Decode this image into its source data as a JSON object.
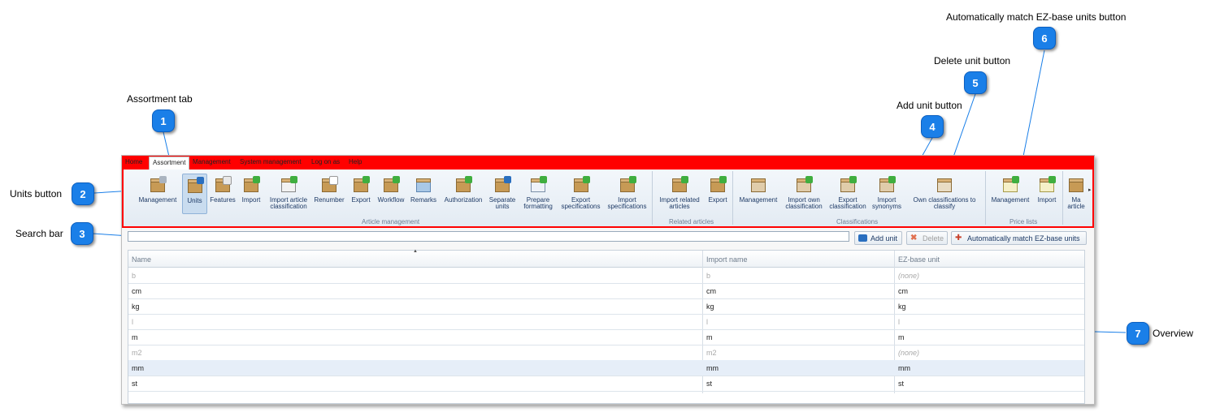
{
  "callouts": [
    {
      "number": "1",
      "label": "Assortment tab"
    },
    {
      "number": "2",
      "label": "Units button"
    },
    {
      "number": "3",
      "label": "Search bar"
    },
    {
      "number": "4",
      "label": "Add unit button"
    },
    {
      "number": "5",
      "label": "Delete unit button"
    },
    {
      "number": "6",
      "label": "Automatically match EZ-base units button"
    },
    {
      "number": "7",
      "label": "Overview"
    }
  ],
  "menu": [
    "Home",
    "Assortment",
    "Management",
    "System management",
    "Log on as",
    "Help"
  ],
  "ribbon": {
    "article_management": [
      "Management",
      "Units",
      "Features",
      "Import",
      "Import article classification",
      "Renumber",
      "Export",
      "Workflow",
      "Remarks",
      "Authorization",
      "Separate units",
      "Prepare formatting",
      "Export specifications",
      "Import specifications"
    ],
    "related_articles": [
      "Import related articles",
      "Export"
    ],
    "classifications": [
      "Management",
      "Import own classification",
      "Export classification",
      "Import synonyms",
      "Own classifications to classify"
    ],
    "price_lists": [
      "Management",
      "Import"
    ],
    "overflow": "Ma article",
    "group_labels": {
      "article_management": "Article management",
      "related_articles": "Related articles",
      "classifications": "Classifications",
      "price_lists": "Price lists"
    }
  },
  "toolbar": {
    "search_value": "",
    "add_unit": "Add unit",
    "delete": "Delete",
    "auto_match": "Automatically match EZ-base units"
  },
  "grid": {
    "columns": [
      "Name",
      "Import name",
      "EZ-base unit"
    ],
    "rows": [
      {
        "name": "b",
        "import_name": "b",
        "ez_base_unit": "(none)"
      },
      {
        "name": "cm",
        "import_name": "cm",
        "ez_base_unit": "cm"
      },
      {
        "name": "kg",
        "import_name": "kg",
        "ez_base_unit": "kg"
      },
      {
        "name": "l",
        "import_name": "l",
        "ez_base_unit": "l"
      },
      {
        "name": "m",
        "import_name": "m",
        "ez_base_unit": "m"
      },
      {
        "name": "m2",
        "import_name": "m2",
        "ez_base_unit": "(none)"
      },
      {
        "name": "mm",
        "import_name": "mm",
        "ez_base_unit": "mm"
      },
      {
        "name": "st",
        "import_name": "st",
        "ez_base_unit": "st"
      }
    ]
  },
  "colors": {
    "callout_blue": "#1a7fe8",
    "highlight_red": "#ff0000"
  }
}
